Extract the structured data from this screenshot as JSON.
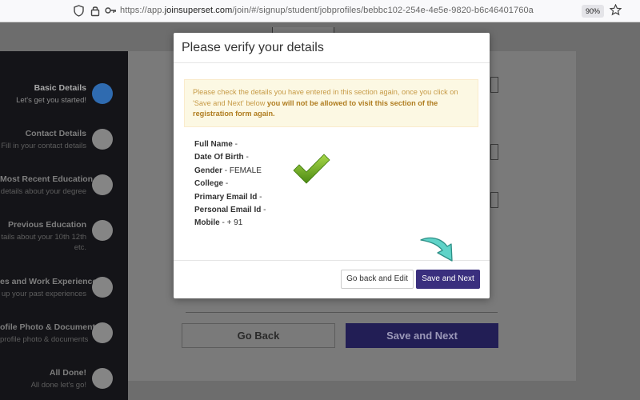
{
  "browser": {
    "url_prefix": "https://app.",
    "url_domain": "joinsuperset.com",
    "url_path": "/join/#/signup/student/jobprofiles/bebbc102-254e-4e5e-9820-b6c46401760a",
    "zoom": "90%"
  },
  "sidebar": {
    "steps": [
      {
        "title": "Basic Details",
        "sub": "Let's get you started!",
        "active": true
      },
      {
        "title": "Contact Details",
        "sub": "Fill in your contact details"
      },
      {
        "title": "Most Recent Education",
        "sub": "details about your degree"
      },
      {
        "title": "Previous Education",
        "sub": "tails about your 10th 12th",
        "sub2": "etc."
      },
      {
        "title": "es and Work Experience",
        "sub": "up your past experiences"
      },
      {
        "title": "ofile Photo & Documents",
        "sub": "profile photo & documents"
      },
      {
        "title": "All Done!",
        "sub": "All done let's go!"
      }
    ]
  },
  "background": {
    "go_back_label": "Go Back",
    "save_next_label": "Save and Next"
  },
  "modal": {
    "title": "Please verify your details",
    "alert_text": "Please check the details you have entered in this section again, once you click on 'Save and Next' below ",
    "alert_bold": "you will not be allowed to visit this section of the registration form again.",
    "fields": [
      {
        "label": "Full Name",
        "value": ""
      },
      {
        "label": "Date Of Birth",
        "value": ""
      },
      {
        "label": "Gender",
        "value": "FEMALE"
      },
      {
        "label": "College",
        "value": ""
      },
      {
        "label": "Primary Email Id",
        "value": ""
      },
      {
        "label": "Personal Email Id",
        "value": ""
      },
      {
        "label": "Mobile",
        "value": "+ 91"
      }
    ],
    "edit_label": "Go back and Edit",
    "next_label": "Save and Next"
  },
  "colors": {
    "accent": "#3a2f7e",
    "active_step": "#2f6bb0",
    "check": "#6aa820",
    "arrow": "#4fc9c0"
  }
}
